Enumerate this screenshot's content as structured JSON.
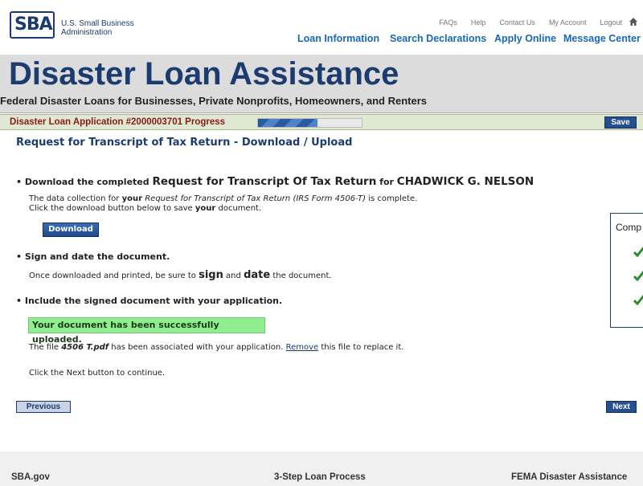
{
  "logo": {
    "mark": "SBA",
    "line1": "U.S. Small Business",
    "line2": "Administration"
  },
  "utility_nav": [
    "FAQs",
    "Help",
    "Contact Us",
    "My Account",
    "Logout"
  ],
  "main_nav": [
    "Loan Information",
    "Search Declarations",
    "Apply Online",
    "Message Center"
  ],
  "banner": {
    "title": "Disaster Loan Assistance",
    "subtitle": "Federal Disaster Loans for Businesses, Private Nonprofits, Homeowners, and Renters"
  },
  "progress": {
    "label": "Disaster Loan Application #2000003701  Progress",
    "fraction": 0.57,
    "save_label": "Save"
  },
  "page_title": "Request for Transcript of Tax Return - Download / Upload",
  "step1": {
    "lead": "Download the completed",
    "doc": "Request for Transcript Of Tax Return",
    "for": "for",
    "name": "CHADWICK G. NELSON",
    "p1_a": "The data collection for",
    "p1_b": "your",
    "p1_c": "Request for Transcript of Tax Return (IRS Form 4506-T)",
    "p1_d": "is complete.",
    "p2_a": "Click the download button below to save",
    "p2_b": "your",
    "p2_c": "document.",
    "download_label": "Download"
  },
  "step2": {
    "heading": "Sign and date the document.",
    "p_a": "Once downloaded and printed, be sure to",
    "p_sign": "sign",
    "p_and": "and",
    "p_date": "date",
    "p_b": "the document."
  },
  "step3": {
    "heading": "Include the signed document with your application.",
    "success": "Your document has been successfully uploaded.",
    "p_a": "The file",
    "file": "4506 T.pdf",
    "p_b": "has been associated with your application.",
    "remove_link": "Remove",
    "p_c": "this file to replace it.",
    "next_hint": "Click the Next button to continue."
  },
  "sidebox": {
    "title": "Comp"
  },
  "buttons": {
    "previous": "Previous",
    "next": "Next"
  },
  "footer": [
    "SBA.gov",
    "3-Step Loan Process",
    "FEMA Disaster Assistance"
  ]
}
